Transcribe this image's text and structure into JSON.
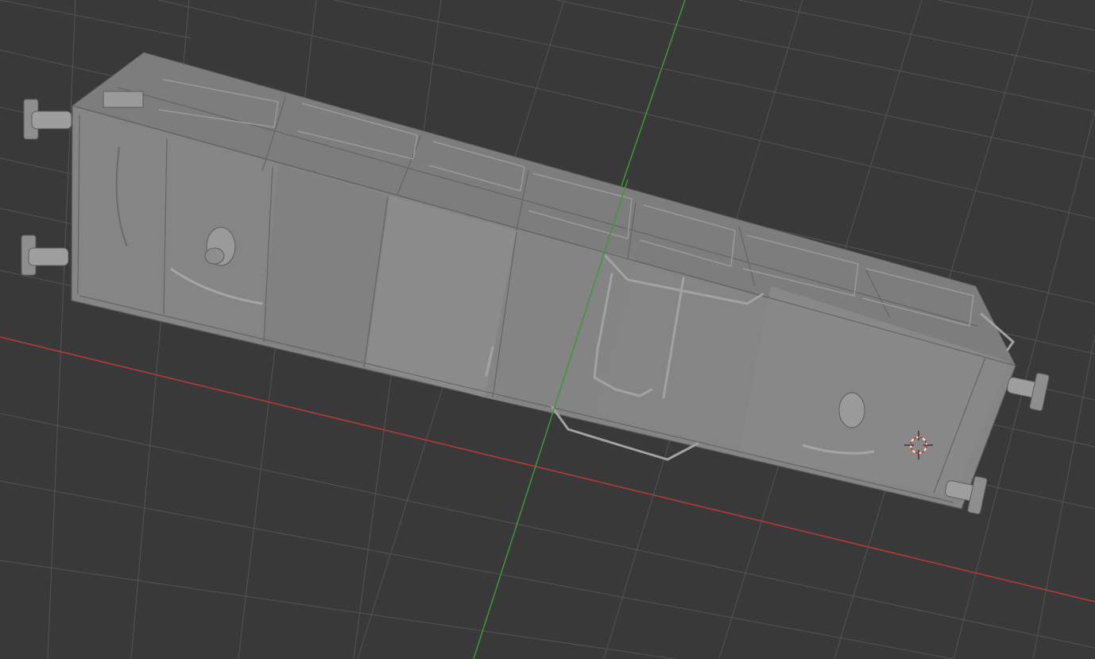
{
  "viewport": {
    "kind": "3d-viewport",
    "shading": "solid",
    "background_color": "#393939",
    "grid_color": "#545454",
    "x_axis_color": "#b83a3a",
    "y_axis_color": "#3c9a33",
    "object": {
      "semantic": "railway-wagon-model",
      "body_color": "#8a8a8a",
      "edge_color": "#6a6a6a",
      "highlight_color": "#a8a8a8"
    },
    "cursor_3d": {
      "semantic": "3d-cursor-icon",
      "ring_color_a": "#d33a3a",
      "ring_color_b": "#f2f2f2"
    }
  }
}
